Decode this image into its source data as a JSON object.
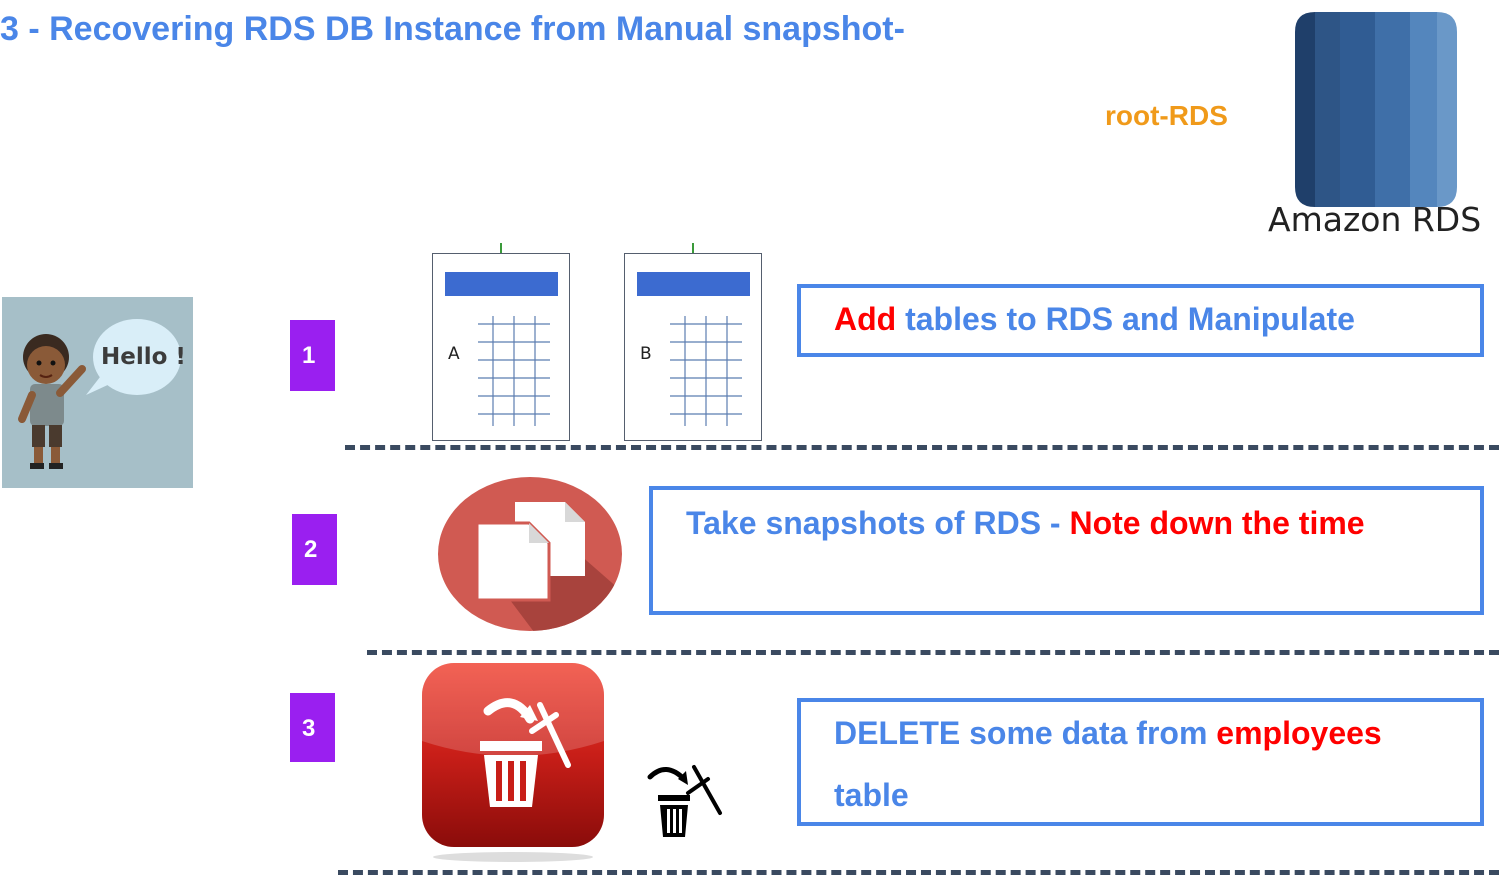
{
  "title": "3 - Recovering RDS DB Instance from Manual snapshot-",
  "service": {
    "label": "root-RDS",
    "caption": "Amazon RDS",
    "icon": "amazon-rds-icon"
  },
  "greeting": {
    "speech": "Hello !",
    "icon": "waving-person-icon"
  },
  "steps": [
    {
      "number": "1",
      "accent": "Add",
      "text": " tables to RDS and Manipulate",
      "tables": [
        "A",
        "B"
      ]
    },
    {
      "number": "2",
      "text": "Take snapshots of RDS - ",
      "accent": "Note down the time",
      "icon": "copy-snapshot-icon"
    },
    {
      "number": "3",
      "text_before": "DELETE some data from ",
      "accent": "employees",
      "text_after": "table",
      "icon": "delete-trash-icon"
    }
  ],
  "colors": {
    "title": "#4a86e8",
    "service_label": "#f09a1a",
    "accent": "#ff0000",
    "badge": "#9a1ff0",
    "box_border": "#4a86e8"
  }
}
